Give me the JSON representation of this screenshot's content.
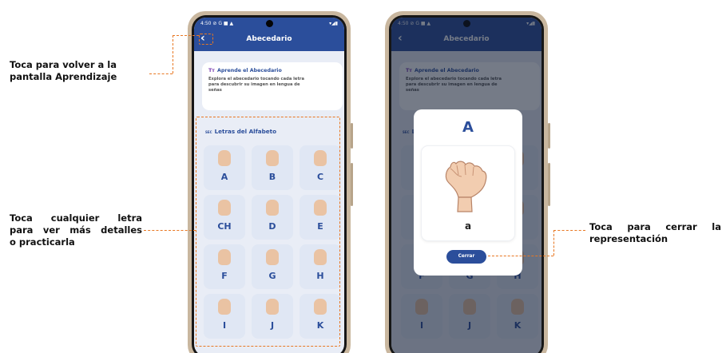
{
  "annotations": {
    "back": [
      "Toca para volver a la",
      "pantalla Aprendizaje"
    ],
    "letter": [
      "Toca cualquier letra",
      "para ver más detalles",
      "o practicarla"
    ],
    "close": [
      "Toca para cerrar la",
      "representación"
    ]
  },
  "status": {
    "time": "4:50 ⊘ G ■ ▲",
    "icons": "▾◢▮"
  },
  "appbar": {
    "back_icon": "‹",
    "title": "Abecedario"
  },
  "infocard": {
    "icon": "Tт",
    "title": "Aprende el Abecedario",
    "desc": [
      "Explora el abecedario tocando cada letra",
      "para descubrir su imagen en lengua de",
      "señas"
    ]
  },
  "section": {
    "icon": "SEC",
    "title": "Letras del Alfabeto"
  },
  "letters": [
    "A",
    "B",
    "C",
    "CH",
    "D",
    "E",
    "F",
    "G",
    "H",
    "I",
    "J",
    "K"
  ],
  "modal": {
    "letter": "A",
    "lower": "a",
    "close_label": "Cerrar"
  },
  "colors": {
    "primary": "#2b4e9b",
    "accent": "#e87722",
    "tile": "#e0e7f4",
    "screen_bg": "#e9edf6"
  }
}
